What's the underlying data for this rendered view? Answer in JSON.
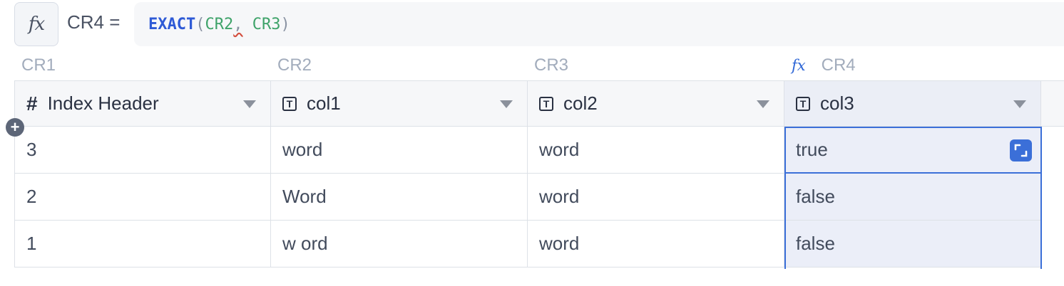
{
  "formula_bar": {
    "fx_label": "fx",
    "target_label": "CR4 =",
    "function_name": "EXACT",
    "open_paren": "(",
    "arg1": "CR2",
    "comma": ",",
    "arg2": "CR3",
    "close_paren": ")"
  },
  "column_refs": [
    "CR1",
    "CR2",
    "CR3",
    "CR4"
  ],
  "formula_column_icon": "fx",
  "headers": [
    {
      "label": "Index Header",
      "icon": "hash-icon"
    },
    {
      "label": "col1",
      "icon": "text-type-icon"
    },
    {
      "label": "col2",
      "icon": "text-type-icon"
    },
    {
      "label": "col3",
      "icon": "text-type-icon"
    }
  ],
  "rows": [
    [
      "3",
      "word",
      "word",
      "true"
    ],
    [
      "2",
      "Word",
      "word",
      "false"
    ],
    [
      "1",
      "w ord",
      "word",
      "false"
    ]
  ],
  "colors": {
    "accent": "#3b6fd8",
    "formula_function": "#2e5ad6",
    "formula_reference": "#3fa36a",
    "selected_column_bg": "#ebeef8"
  }
}
